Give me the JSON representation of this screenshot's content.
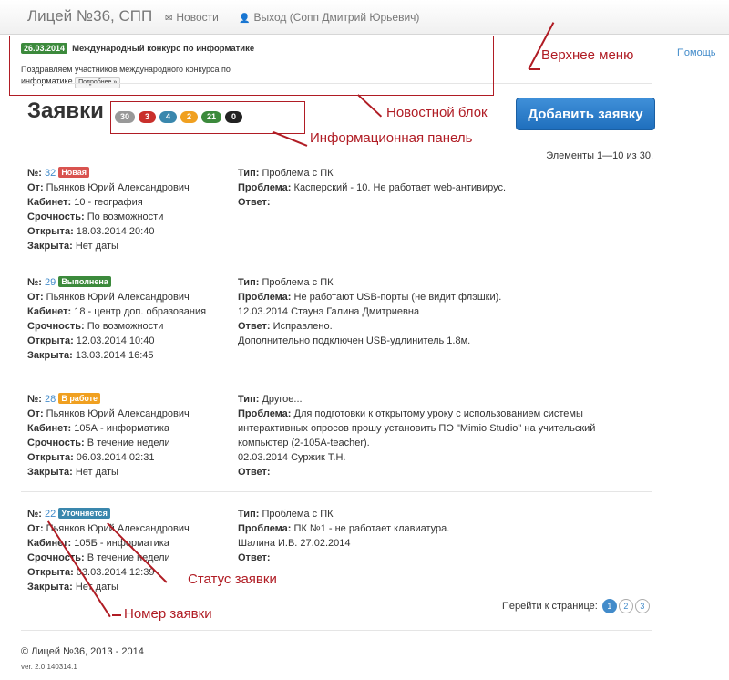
{
  "navbar": {
    "brand": "Лицей №36, СПП",
    "news": "Новости",
    "logout": "Выход (Сопп Дмитрий Юрьевич)"
  },
  "help": "Помощь",
  "news_block": {
    "date": "26.03.2014",
    "title": "Международный конкурс по информатике",
    "text": "Поздравляем участников международного конкурса по информатике",
    "more": "Подробнее »"
  },
  "page_title": "Заявки",
  "badges": [
    {
      "value": "30",
      "color": "#999999"
    },
    {
      "value": "3",
      "color": "#c9302c"
    },
    {
      "value": "4",
      "color": "#3a87ad"
    },
    {
      "value": "2",
      "color": "#f0a020"
    },
    {
      "value": "21",
      "color": "#3c8a3c"
    },
    {
      "value": "0",
      "color": "#222222"
    }
  ],
  "add_button": "Добавить заявку",
  "elements_info": "Элементы 1—10 из 30.",
  "labels": {
    "number": "№:",
    "from": "От:",
    "cabinet": "Кабинет:",
    "urgency": "Срочность:",
    "opened": "Открыта:",
    "closed": "Закрыта:",
    "type": "Тип:",
    "problem": "Проблема:",
    "answer": "Ответ:"
  },
  "tickets": [
    {
      "number": "32",
      "status": "Новая",
      "status_color": "#d9534f",
      "from": "Пьянков Юрий Александрович",
      "cabinet": "10 - география",
      "urgency": "По возможности",
      "opened": "18.03.2014 20:40",
      "closed": "Нет даты",
      "type": "Проблема с ПК",
      "problem": "Касперский - 10. Не работает web-антивирус.",
      "problem_extra": "",
      "answer": "",
      "answer_extra": ""
    },
    {
      "number": "29",
      "status": "Выполнена",
      "status_color": "#3c8a3c",
      "from": "Пьянков Юрий Александрович",
      "cabinet": "18 - центр доп. образования",
      "urgency": "По возможности",
      "opened": "12.03.2014 10:40",
      "closed": "13.03.2014 16:45",
      "type": "Проблема с ПК",
      "problem": "Не работают USB-порты (не видит флэшки).",
      "problem_extra": "12.03.2014 Стаунэ Галина Дмитриевна",
      "answer": "Исправлено.",
      "answer_extra": "Дополнительно подключен USB-удлинитель 1.8м."
    },
    {
      "number": "28",
      "status": "В работе",
      "status_color": "#f0a020",
      "from": "Пьянков Юрий Александрович",
      "cabinet": "105А - информатика",
      "urgency": "В течение недели",
      "opened": "06.03.2014 02:31",
      "closed": "Нет даты",
      "type": "Другое...",
      "problem": "Для подготовки к открытому уроку с использованием системы интерактивных опросов прошу установить ПО \"Mimio Studio\" на учительский компьютер (2-105А-teacher).",
      "problem_extra": "02.03.2014 Суржик Т.Н.",
      "answer": "",
      "answer_extra": ""
    },
    {
      "number": "22",
      "status": "Уточняется",
      "status_color": "#3a87ad",
      "from": "Пьянков Юрий Александрович",
      "cabinet": "105Б - информатика",
      "urgency": "В течение недели",
      "opened": "03.03.2014 12:39",
      "closed": "Нет даты",
      "type": "Проблема с ПК",
      "problem": "ПК №1 - не работает клавиатура.",
      "problem_extra": "Шалина И.В. 27.02.2014",
      "answer": "",
      "answer_extra": ""
    }
  ],
  "pager": {
    "label": "Перейти к странице:",
    "pages": [
      "1",
      "2",
      "3"
    ],
    "active": "1"
  },
  "footer": "© Лицей №36, 2013 - 2014",
  "version": "ver. 2.0.140314.1",
  "annotations": {
    "top_menu": "Верхнее меню",
    "news_block": "Новостной блок",
    "info_panel": "Информационная панель",
    "ticket_status": "Статус заявки",
    "ticket_number": "Номер заявки"
  }
}
